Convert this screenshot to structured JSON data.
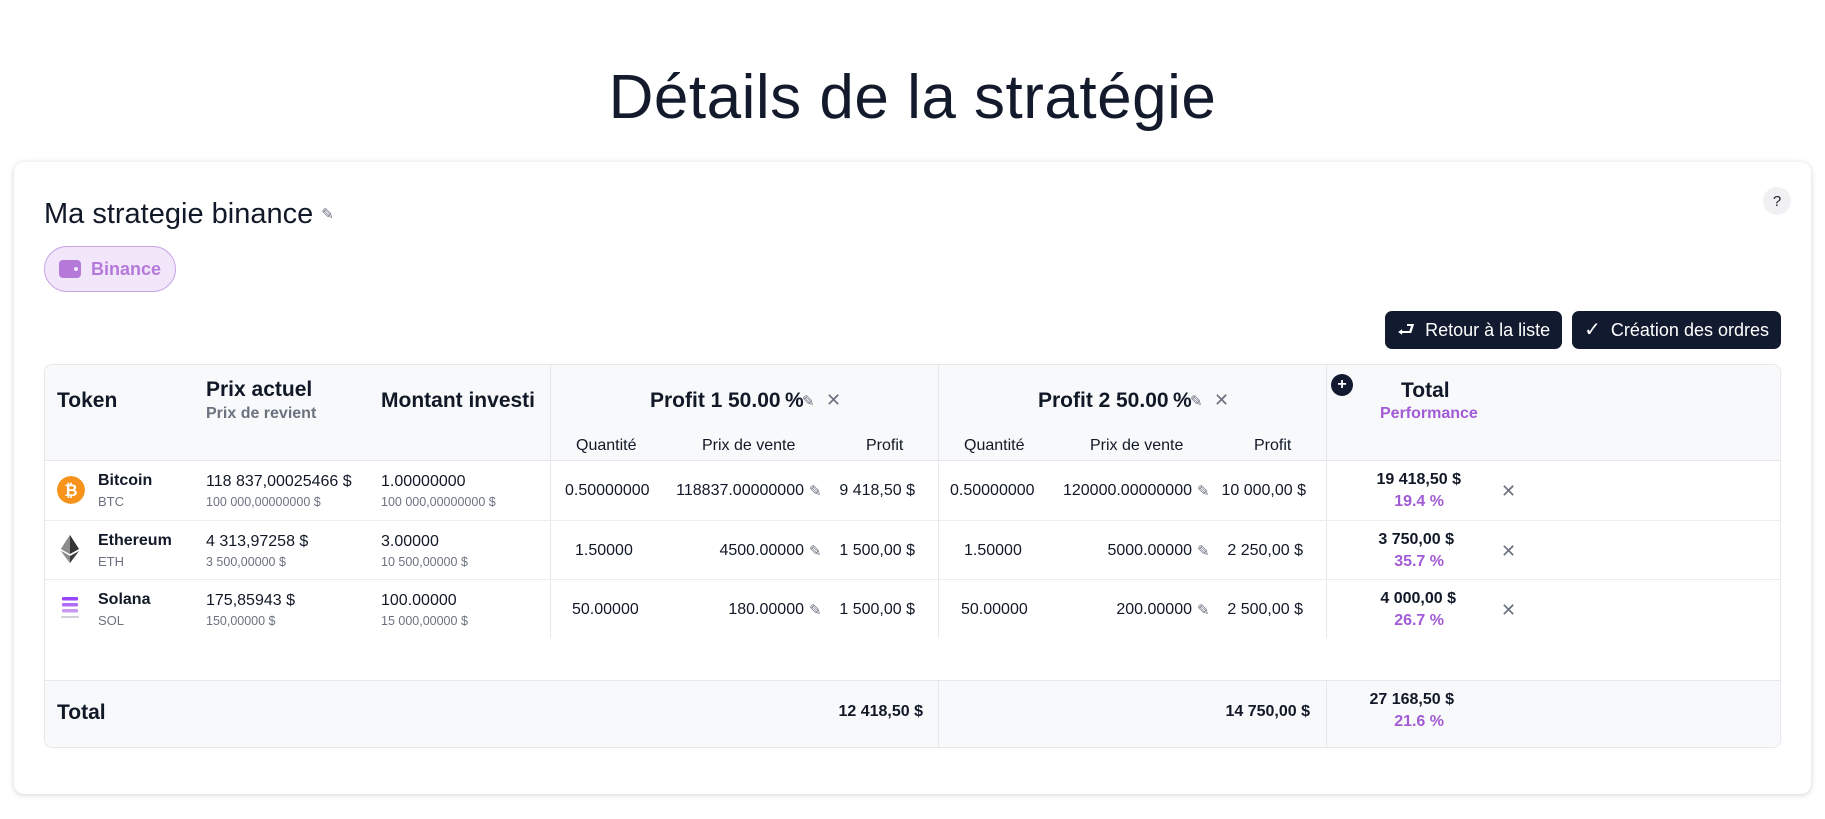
{
  "page_title": "Détails de la stratégie",
  "help_label": "?",
  "strategy": {
    "name": "Ma strategie binance",
    "exchange": "Binance"
  },
  "actions": {
    "back_label": "Retour à la liste",
    "create_label": "Création des ordres"
  },
  "table": {
    "col_token": "Token",
    "col_price": "Prix actuel",
    "col_price_sub": "Prix de revient",
    "col_invested": "Montant investi",
    "col_total": "Total",
    "col_total_sub": "Performance",
    "add_profit_label": "+",
    "profits": [
      {
        "label": "Profit 1",
        "percent": "50.00",
        "percent_unit": "%",
        "sub_qty": "Quantité",
        "sub_price": "Prix de vente",
        "sub_profit": "Profit",
        "total": "12 418,50 $"
      },
      {
        "label": "Profit 2",
        "percent": "50.00",
        "percent_unit": "%",
        "sub_qty": "Quantité",
        "sub_price": "Prix de vente",
        "sub_profit": "Profit",
        "total": "14 750,00 $"
      }
    ],
    "rows": [
      {
        "name": "Bitcoin",
        "symbol": "BTC",
        "price": "118 837,00025466 $",
        "cost": "100 000,00000000 $",
        "qty": "1.00000000",
        "invested": "100 000,00000000 $",
        "p1_qty": "0.50000000",
        "p1_price": "118837.00000000",
        "p1_profit": "9 418,50 $",
        "p2_qty": "0.50000000",
        "p2_price": "120000.00000000",
        "p2_profit": "10 000,00 $",
        "total": "19 418,50 $",
        "perf": "19.4 %"
      },
      {
        "name": "Ethereum",
        "symbol": "ETH",
        "price": "4 313,97258 $",
        "cost": "3 500,00000 $",
        "qty": "3.00000",
        "invested": "10 500,00000 $",
        "p1_qty": "1.50000",
        "p1_price": "4500.00000",
        "p1_profit": "1 500,00 $",
        "p2_qty": "1.50000",
        "p2_price": "5000.00000",
        "p2_profit": "2 250,00 $",
        "total": "3 750,00 $",
        "perf": "35.7 %"
      },
      {
        "name": "Solana",
        "symbol": "SOL",
        "price": "175,85943 $",
        "cost": "150,00000 $",
        "qty": "100.00000",
        "invested": "15 000,00000 $",
        "p1_qty": "50.00000",
        "p1_price": "180.00000",
        "p1_profit": "1 500,00 $",
        "p2_qty": "50.00000",
        "p2_price": "200.00000",
        "p2_profit": "2 500,00 $",
        "total": "4 000,00 $",
        "perf": "26.7 %"
      }
    ],
    "footer": {
      "label": "Total",
      "total": "27 168,50 $",
      "perf": "21.6 %"
    }
  },
  "colors": {
    "dark": "#111a2e",
    "accent": "#a25bd6",
    "badge_bg": "#f2e6fb",
    "btc": "#f7931a"
  }
}
